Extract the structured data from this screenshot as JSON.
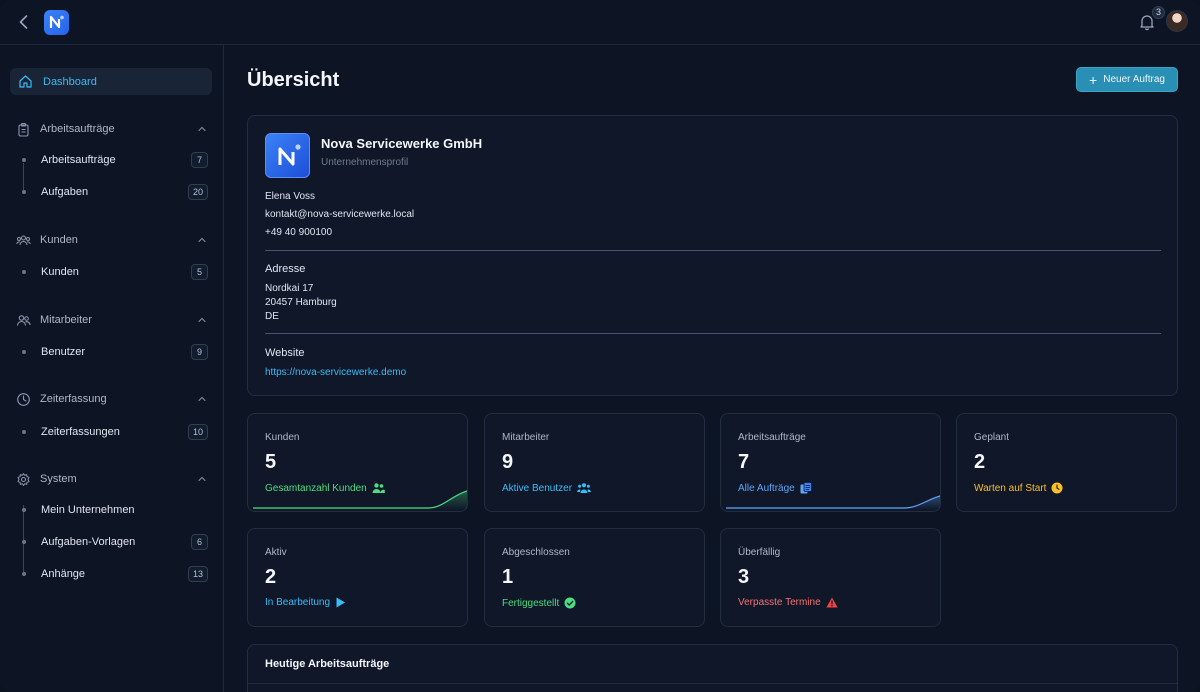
{
  "topbar": {
    "notifications_count": "3"
  },
  "sidebar": {
    "dashboard": "Dashboard",
    "groups": [
      {
        "label": "Arbeitsaufträge",
        "items": [
          {
            "label": "Arbeitsaufträge",
            "count": "7"
          },
          {
            "label": "Aufgaben",
            "count": "20"
          }
        ]
      },
      {
        "label": "Kunden",
        "items": [
          {
            "label": "Kunden",
            "count": "5"
          }
        ]
      },
      {
        "label": "Mitarbeiter",
        "items": [
          {
            "label": "Benutzer",
            "count": "9"
          }
        ]
      },
      {
        "label": "Zeiterfassung",
        "items": [
          {
            "label": "Zeiterfassungen",
            "count": "10"
          }
        ]
      },
      {
        "label": "System",
        "items": [
          {
            "label": "Mein Unternehmen",
            "count": ""
          },
          {
            "label": "Aufgaben-Vorlagen",
            "count": "6"
          },
          {
            "label": "Anhänge",
            "count": "13"
          }
        ]
      }
    ]
  },
  "main": {
    "title": "Übersicht",
    "new_button": "Neuer Auftrag",
    "profile": {
      "company": "Nova Servicewerke GmbH",
      "subtitle": "Unternehmensprofil",
      "contact_name": "Elena Voss",
      "email": "kontakt@nova-servicewerke.local",
      "phone": "+49 40 900100",
      "address_label": "Adresse",
      "street": "Nordkai 17",
      "city": "20457 Hamburg",
      "country": "DE",
      "website_label": "Website",
      "website": "https://nova-servicewerke.demo"
    },
    "stats": [
      {
        "label": "Kunden",
        "value": "5",
        "sub": "Gesamtanzahl Kunden",
        "color": "#4ade80"
      },
      {
        "label": "Mitarbeiter",
        "value": "9",
        "sub": "Aktive Benutzer",
        "color": "#38bdf8"
      },
      {
        "label": "Arbeitsaufträge",
        "value": "7",
        "sub": "Alle Aufträge",
        "color": "#60a5fa"
      },
      {
        "label": "Geplant",
        "value": "2",
        "sub": "Warten auf Start",
        "color": "#fbbf24"
      },
      {
        "label": "Aktiv",
        "value": "2",
        "sub": "In Bearbeitung",
        "color": "#38bdf8"
      },
      {
        "label": "Abgeschlossen",
        "value": "1",
        "sub": "Fertiggestellt",
        "color": "#4ade80"
      },
      {
        "label": "Überfällig",
        "value": "3",
        "sub": "Verpasste Termine",
        "color": "#f87171"
      }
    ],
    "today_title": "Heutige Arbeitsaufträge"
  }
}
